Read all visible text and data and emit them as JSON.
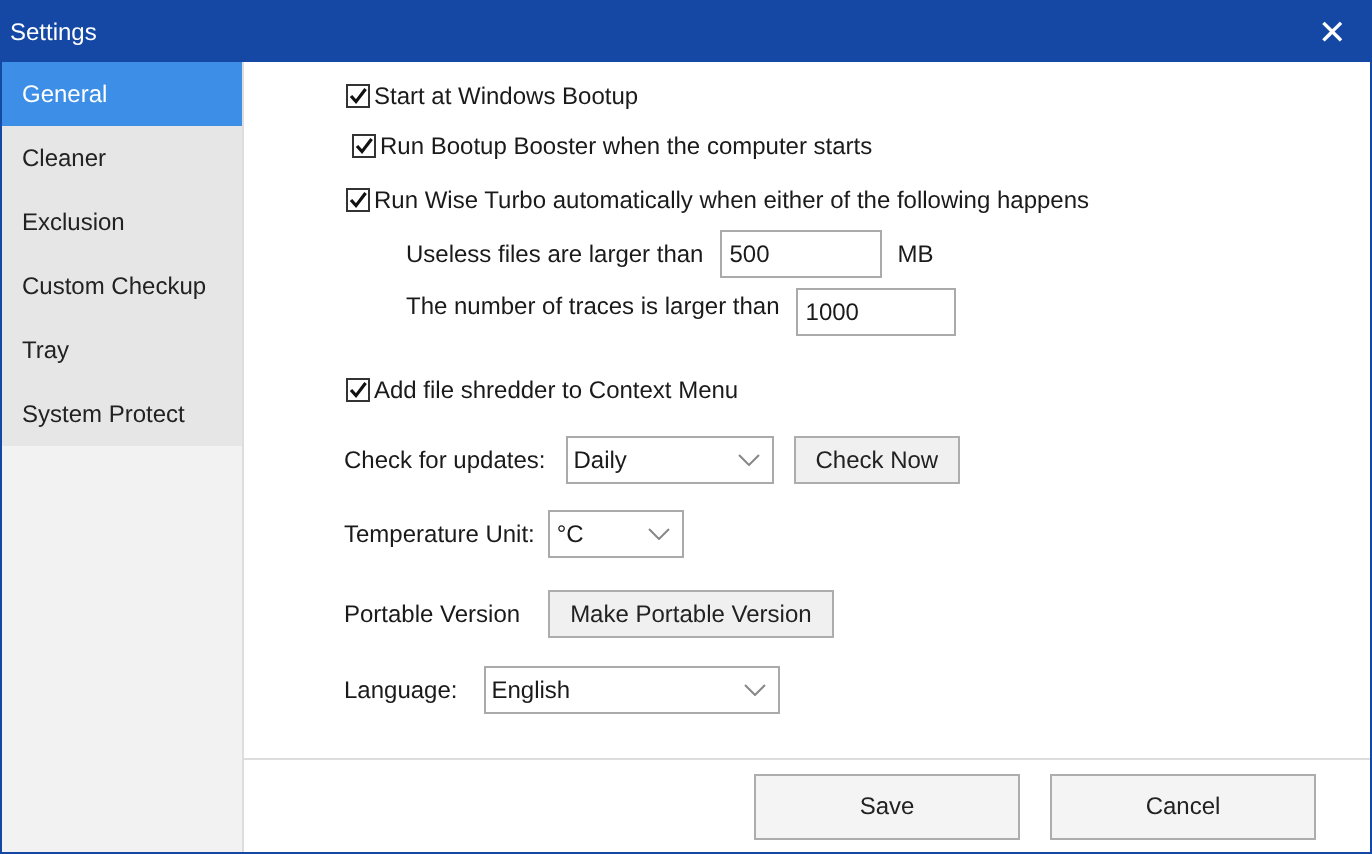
{
  "window": {
    "title": "Settings",
    "close": "✕"
  },
  "sidebar": {
    "items": [
      {
        "label": "General",
        "selected": true
      },
      {
        "label": "Cleaner",
        "selected": false
      },
      {
        "label": "Exclusion",
        "selected": false
      },
      {
        "label": "Custom Checkup",
        "selected": false
      },
      {
        "label": "Tray",
        "selected": false
      },
      {
        "label": "System Protect",
        "selected": false
      }
    ]
  },
  "general": {
    "start_at_bootup": {
      "label": "Start at Windows Bootup",
      "checked": true
    },
    "run_bootup_booster": {
      "label": "Run Bootup Booster when the computer starts",
      "checked": true
    },
    "run_wise_turbo": {
      "label": "Run Wise Turbo automatically when either of the following happens",
      "checked": true
    },
    "useless_files": {
      "label": "Useless files are larger than",
      "value": "500",
      "unit": "MB"
    },
    "traces": {
      "label": "The number of traces is larger than",
      "value": "1000"
    },
    "file_shredder": {
      "label": "Add file shredder to Context Menu",
      "checked": true
    },
    "check_for_updates": {
      "label": "Check for updates:",
      "value": "Daily",
      "button": "Check Now"
    },
    "temperature_unit": {
      "label": "Temperature Unit:",
      "value": "°C"
    },
    "portable_version": {
      "label": "Portable Version",
      "button": "Make Portable Version"
    },
    "language": {
      "label": "Language:",
      "value": "English"
    }
  },
  "buttons": [
    "Save",
    "Cancel"
  ]
}
